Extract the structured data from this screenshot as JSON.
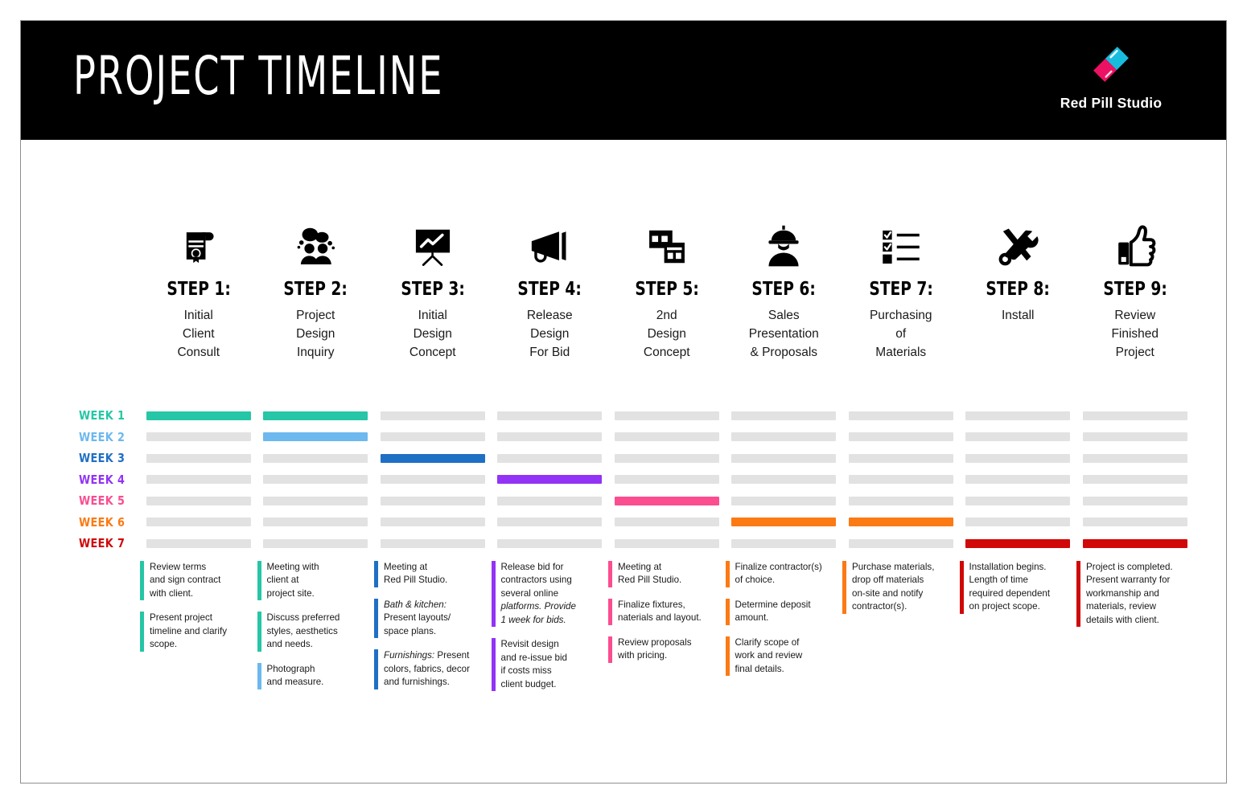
{
  "header": {
    "title": "PROJECT TIMELINE",
    "background": "#000000",
    "logo": {
      "name": "Red Pill Studio",
      "icon": "pill-capsule-icon",
      "color_left": "#ED1164",
      "color_right": "#18BDDE"
    }
  },
  "palette": {
    "week1": "#26C6A6",
    "week2": "#6DB8EE",
    "week3": "#1F6FC4",
    "week4": "#9333F5",
    "week5": "#FB4D90",
    "week6": "#FB7A14",
    "week7": "#D00808",
    "empty": "#e2e2e2"
  },
  "steps": [
    {
      "num": "STEP 1:",
      "desc": "Initial\nClient\nConsult",
      "icon": "certificate-icon"
    },
    {
      "num": "STEP 2:",
      "desc": "Project\nDesign\nInquiry",
      "icon": "people-talking-icon"
    },
    {
      "num": "STEP 3:",
      "desc": "Initial\nDesign\nConcept",
      "icon": "presentation-board-icon"
    },
    {
      "num": "STEP 4:",
      "desc": "Release\nDesign\nFor Bid",
      "icon": "megaphone-icon"
    },
    {
      "num": "STEP 5:",
      "desc": "2nd\nDesign\nConcept",
      "icon": "layout-blocks-icon"
    },
    {
      "num": "STEP 6:",
      "desc": "Sales\nPresentation\n& Proposals",
      "icon": "construction-worker-icon"
    },
    {
      "num": "STEP 7:",
      "desc": "Purchasing\nof\nMaterials",
      "icon": "checklist-icon"
    },
    {
      "num": "STEP 8:",
      "desc": "Install",
      "icon": "tools-icon"
    },
    {
      "num": "STEP 9:",
      "desc": "Review\nFinished\nProject",
      "icon": "thumbs-up-icon"
    }
  ],
  "chart_data": {
    "type": "bar",
    "title": "Project Timeline",
    "xlabel": "",
    "ylabel": "",
    "categories": [
      "STEP 1",
      "STEP 2",
      "STEP 3",
      "STEP 4",
      "STEP 5",
      "STEP 6",
      "STEP 7",
      "STEP 8",
      "STEP 9"
    ],
    "rows": [
      {
        "label": "WEEK 1",
        "color": "#26C6A6",
        "filled": [
          1,
          1,
          0,
          0,
          0,
          0,
          0,
          0,
          0
        ]
      },
      {
        "label": "WEEK 2",
        "color": "#6DB8EE",
        "filled": [
          0,
          1,
          0,
          0,
          0,
          0,
          0,
          0,
          0
        ]
      },
      {
        "label": "WEEK 3",
        "color": "#1F6FC4",
        "filled": [
          0,
          0,
          1,
          0,
          0,
          0,
          0,
          0,
          0
        ]
      },
      {
        "label": "WEEK 4",
        "color": "#9333F5",
        "filled": [
          0,
          0,
          0,
          1,
          0,
          0,
          0,
          0,
          0
        ]
      },
      {
        "label": "WEEK 5",
        "color": "#FB4D90",
        "filled": [
          0,
          0,
          0,
          0,
          1,
          0,
          0,
          0,
          0
        ]
      },
      {
        "label": "WEEK 6",
        "color": "#FB7A14",
        "filled": [
          0,
          0,
          0,
          0,
          0,
          1,
          1,
          0,
          0
        ]
      },
      {
        "label": "WEEK 7",
        "color": "#D00808",
        "filled": [
          0,
          0,
          0,
          0,
          0,
          0,
          0,
          1,
          1
        ]
      }
    ]
  },
  "notes": [
    {
      "step": 1,
      "items": [
        {
          "color": "#26C6A6",
          "text": "Review terms\n and sign contract\nwith client."
        },
        {
          "color": "#26C6A6",
          "text": "Present project\ntimeline and clarify\nscope."
        }
      ]
    },
    {
      "step": 2,
      "items": [
        {
          "color": "#26C6A6",
          "text": "Meeting with\nclient at\nproject site."
        },
        {
          "color": "#26C6A6",
          "text": "Discuss preferred\nstyles, aesthetics\nand needs."
        },
        {
          "color": "#6DB8EE",
          "text": "Photograph\nand measure."
        }
      ]
    },
    {
      "step": 3,
      "items": [
        {
          "color": "#1F6FC4",
          "text": "Meeting at\nRed Pill Studio."
        },
        {
          "color": "#1F6FC4",
          "italic_lead": "Bath & kitchen:",
          "text": "\nPresent layouts/\nspace plans."
        },
        {
          "color": "#1F6FC4",
          "italic_lead": "Furnishings:",
          "text": " Present\ncolors, fabrics, decor\nand furnishings."
        }
      ]
    },
    {
      "step": 4,
      "items": [
        {
          "color": "#9333F5",
          "text": "Release bid for\ncontractors using\nseveral online\n",
          "italic_tail": "platforms. Provide\n1 week for bids."
        },
        {
          "color": "#9333F5",
          "text": "Revisit design\nand re-issue bid\nif costs miss\nclient budget."
        }
      ]
    },
    {
      "step": 5,
      "items": [
        {
          "color": "#FB4D90",
          "text": "Meeting at\nRed Pill Studio."
        },
        {
          "color": "#FB4D90",
          "text": "Finalize fixtures,\nnaterials and layout."
        },
        {
          "color": "#FB4D90",
          "text": "Review proposals\nwith pricing."
        }
      ]
    },
    {
      "step": 6,
      "items": [
        {
          "color": "#FB7A14",
          "text": "Finalize contractor(s)\nof choice."
        },
        {
          "color": "#FB7A14",
          "text": "Determine deposit\namount."
        },
        {
          "color": "#FB7A14",
          "text": "Clarify scope of\nwork and review\nfinal details."
        }
      ]
    },
    {
      "step": 7,
      "items": [
        {
          "color": "#FB7A14",
          "text": "Purchase materials,\ndrop off materials\non-site and notify\ncontractor(s)."
        }
      ]
    },
    {
      "step": 8,
      "items": [
        {
          "color": "#D00808",
          "text": "Installation begins.\nLength of time\nrequired dependent\non project scope."
        }
      ]
    },
    {
      "step": 9,
      "items": [
        {
          "color": "#D00808",
          "text": "Project is completed.\nPresent warranty for\nworkmanship and\nmaterials, review\ndetails with client."
        }
      ]
    }
  ]
}
